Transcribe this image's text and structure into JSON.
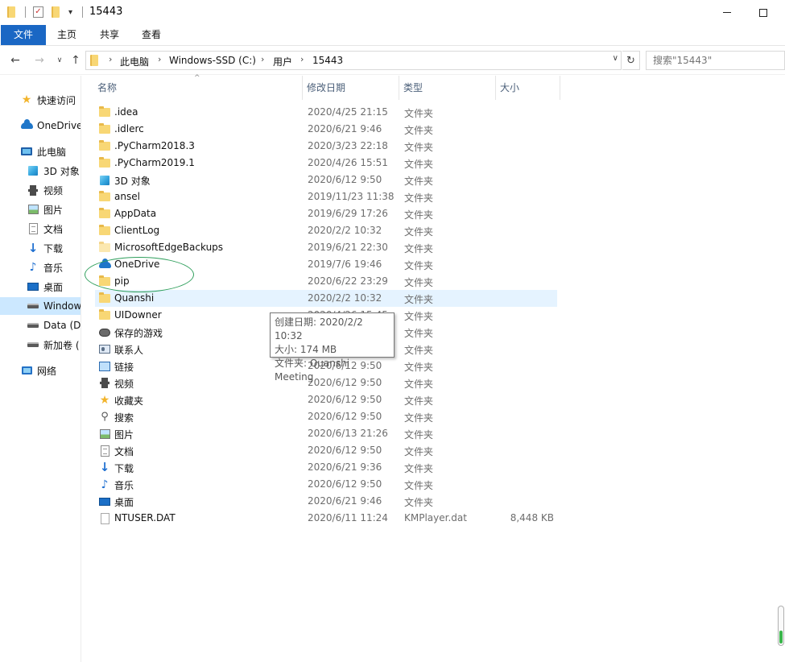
{
  "window": {
    "title": "15443",
    "controls": {
      "minimize": "minimize",
      "maximize": "maximize"
    }
  },
  "ribbon": {
    "tabs": [
      {
        "label": "文件"
      },
      {
        "label": "主页"
      },
      {
        "label": "共享"
      },
      {
        "label": "查看"
      }
    ]
  },
  "address": {
    "crumbs": [
      "此电脑",
      "Windows-SSD (C:)",
      "用户",
      "15443"
    ],
    "search_placeholder": "搜索\"15443\""
  },
  "sidebar": {
    "items": [
      {
        "label": "快速访问",
        "icon": "star-icon"
      },
      {
        "label": "OneDrive",
        "icon": "cloud-icon"
      },
      {
        "label": "此电脑",
        "icon": "computer-icon"
      },
      {
        "label": "3D 对象",
        "icon": "cube-icon"
      },
      {
        "label": "视频",
        "icon": "video-icon"
      },
      {
        "label": "图片",
        "icon": "picture-icon"
      },
      {
        "label": "文档",
        "icon": "document-icon"
      },
      {
        "label": "下载",
        "icon": "download-icon"
      },
      {
        "label": "音乐",
        "icon": "music-icon"
      },
      {
        "label": "桌面",
        "icon": "desktop-icon"
      },
      {
        "label": "Window",
        "icon": "drive-icon"
      },
      {
        "label": "Data (D:",
        "icon": "drive-icon"
      },
      {
        "label": "新加卷 (",
        "icon": "drive-icon"
      },
      {
        "label": "网络",
        "icon": "network-icon"
      }
    ]
  },
  "columns": {
    "name": "名称",
    "date": "修改日期",
    "type": "类型",
    "size": "大小"
  },
  "files": [
    {
      "name": ".idea",
      "date": "2020/4/25 21:15",
      "type": "文件夹",
      "size": "",
      "icon": "folder-icon"
    },
    {
      "name": ".idlerc",
      "date": "2020/6/21 9:46",
      "type": "文件夹",
      "size": "",
      "icon": "folder-icon"
    },
    {
      "name": ".PyCharm2018.3",
      "date": "2020/3/23 22:18",
      "type": "文件夹",
      "size": "",
      "icon": "folder-icon"
    },
    {
      "name": ".PyCharm2019.1",
      "date": "2020/4/26 15:51",
      "type": "文件夹",
      "size": "",
      "icon": "folder-icon"
    },
    {
      "name": "3D 对象",
      "date": "2020/6/12 9:50",
      "type": "文件夹",
      "size": "",
      "icon": "cube-icon"
    },
    {
      "name": "ansel",
      "date": "2019/11/23 11:38",
      "type": "文件夹",
      "size": "",
      "icon": "folder-icon"
    },
    {
      "name": "AppData",
      "date": "2019/6/29 17:26",
      "type": "文件夹",
      "size": "",
      "icon": "folder-icon"
    },
    {
      "name": "ClientLog",
      "date": "2020/2/2 10:32",
      "type": "文件夹",
      "size": "",
      "icon": "folder-icon"
    },
    {
      "name": "MicrosoftEdgeBackups",
      "date": "2019/6/21 22:30",
      "type": "文件夹",
      "size": "",
      "icon": "light-folder-icon"
    },
    {
      "name": "OneDrive",
      "date": "2019/7/6 19:46",
      "type": "文件夹",
      "size": "",
      "icon": "cloud-icon"
    },
    {
      "name": "pip",
      "date": "2020/6/22 23:29",
      "type": "文件夹",
      "size": "",
      "icon": "folder-icon"
    },
    {
      "name": "Quanshi",
      "date": "2020/2/2 10:32",
      "type": "文件夹",
      "size": "",
      "icon": "folder-icon"
    },
    {
      "name": "UIDowner",
      "date": "2020/4/26 15:45",
      "type": "文件夹",
      "size": "",
      "icon": "folder-icon"
    },
    {
      "name": "保存的游戏",
      "date": "2020/6/12 9:50",
      "type": "文件夹",
      "size": "",
      "icon": "game-icon"
    },
    {
      "name": "联系人",
      "date": "2020/6/12 9:50",
      "type": "文件夹",
      "size": "",
      "icon": "contact-icon"
    },
    {
      "name": "链接",
      "date": "2020/6/12 9:50",
      "type": "文件夹",
      "size": "",
      "icon": "link-icon"
    },
    {
      "name": "视频",
      "date": "2020/6/12 9:50",
      "type": "文件夹",
      "size": "",
      "icon": "video-icon"
    },
    {
      "name": "收藏夹",
      "date": "2020/6/12 9:50",
      "type": "文件夹",
      "size": "",
      "icon": "star-icon"
    },
    {
      "name": "搜索",
      "date": "2020/6/12 9:50",
      "type": "文件夹",
      "size": "",
      "icon": "search-icon"
    },
    {
      "name": "图片",
      "date": "2020/6/13 21:26",
      "type": "文件夹",
      "size": "",
      "icon": "picture-icon"
    },
    {
      "name": "文档",
      "date": "2020/6/12 9:50",
      "type": "文件夹",
      "size": "",
      "icon": "document-icon"
    },
    {
      "name": "下载",
      "date": "2020/6/21 9:36",
      "type": "文件夹",
      "size": "",
      "icon": "download-icon"
    },
    {
      "name": "音乐",
      "date": "2020/6/12 9:50",
      "type": "文件夹",
      "size": "",
      "icon": "music-icon"
    },
    {
      "name": "桌面",
      "date": "2020/6/21 9:46",
      "type": "文件夹",
      "size": "",
      "icon": "desktop-icon"
    },
    {
      "name": "NTUSER.DAT",
      "date": "2020/6/11 11:24",
      "type": "KMPlayer.dat",
      "size": "8,448 KB",
      "icon": "file-icon"
    }
  ],
  "tooltip": {
    "lines": [
      "创建日期: 2020/2/2 10:32",
      "大小: 174 MB",
      "文件夹: Quanshi Meeting"
    ]
  },
  "colors": {
    "accent": "#1a67c4",
    "hover": "#e5f3ff",
    "annotation": "#2f9f5c"
  }
}
